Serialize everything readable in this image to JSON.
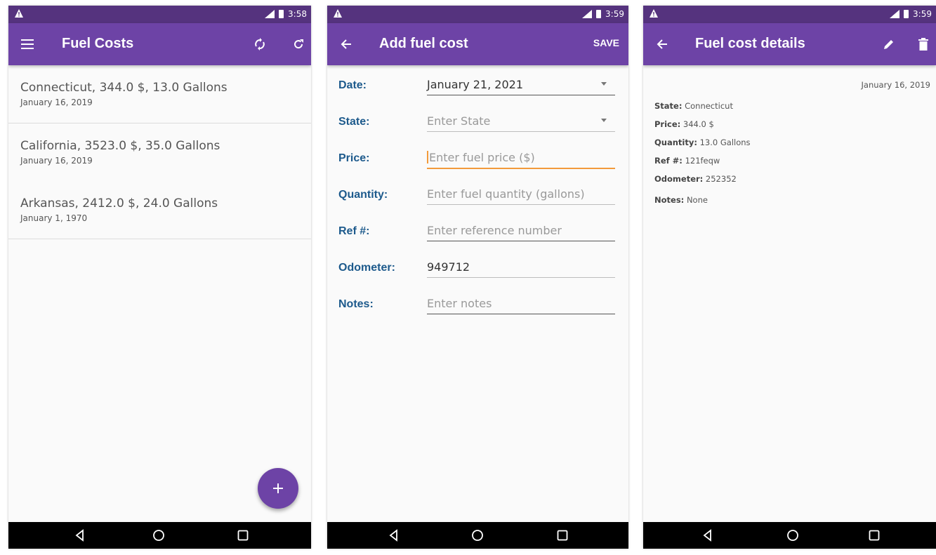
{
  "status": {
    "time1": "3:58",
    "time2": "3:59",
    "time3": "3:59"
  },
  "screen1": {
    "title": "Fuel Costs",
    "items": [
      {
        "primary": "Connecticut, 344.0 $, 13.0 Gallons",
        "secondary": "January 16, 2019"
      },
      {
        "primary": "California, 3523.0 $, 35.0 Gallons",
        "secondary": "January 16, 2019"
      },
      {
        "primary": "Arkansas, 2412.0 $, 24.0 Gallons",
        "secondary": "January 1, 1970"
      }
    ],
    "fab_label": "+"
  },
  "screen2": {
    "title": "Add fuel cost",
    "save_label": "SAVE",
    "fields": {
      "date": {
        "label": "Date:",
        "value": "January 21, 2021"
      },
      "state": {
        "label": "State:",
        "placeholder": "Enter State"
      },
      "price": {
        "label": "Price:",
        "placeholder": "Enter fuel price ($)"
      },
      "quantity": {
        "label": "Quantity:",
        "placeholder": "Enter fuel quantity (gallons)"
      },
      "ref": {
        "label": "Ref #:",
        "placeholder": "Enter reference number"
      },
      "odometer": {
        "label": "Odometer:",
        "value": "949712"
      },
      "notes": {
        "label": "Notes:",
        "placeholder": "Enter notes"
      }
    }
  },
  "screen3": {
    "title": "Fuel cost details",
    "date": "January 16, 2019",
    "rows": [
      {
        "label": "State:",
        "value": "Connecticut"
      },
      {
        "label": "Price:",
        "value": "344.0 $"
      },
      {
        "label": "Quantity:",
        "value": "13.0 Gallons"
      },
      {
        "label": "Ref #:",
        "value": "121feqw"
      },
      {
        "label": "Odometer:",
        "value": "252352"
      },
      {
        "label": "Notes:",
        "value": "None"
      }
    ]
  },
  "icons": {
    "menu": "menu-icon",
    "sync": "sync-icon",
    "refresh": "refresh-icon",
    "back": "arrow-back-icon",
    "edit": "pencil-icon",
    "delete": "trash-icon",
    "nav_back": "nav-back-icon",
    "nav_home": "nav-home-icon",
    "nav_recents": "nav-recents-icon"
  },
  "colors": {
    "status_bar": "#55337e",
    "app_bar": "#6d43a6",
    "label_blue": "#1d5a8c",
    "focus_orange": "#f29a3b"
  }
}
